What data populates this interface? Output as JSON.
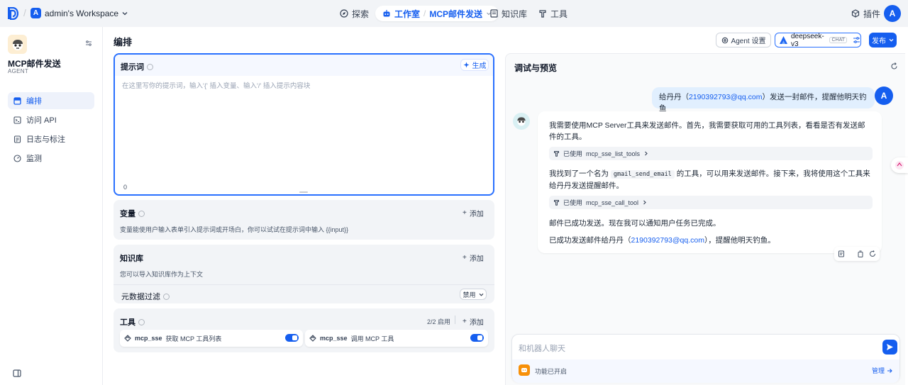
{
  "topbar": {
    "workspace_initial": "A",
    "workspace_name": "admin's Workspace",
    "nav_explore": "探索",
    "nav_studio": "工作室",
    "nav_app": "MCP邮件发送",
    "nav_knowledge": "知识库",
    "nav_tools": "工具",
    "plugins": "插件",
    "user_initial": "A"
  },
  "sidebar": {
    "app_name": "MCP邮件发送",
    "app_type": "AGENT",
    "items": [
      {
        "label": "编排",
        "icon": "layout-icon",
        "active": true
      },
      {
        "label": "访问 API",
        "icon": "terminal-icon",
        "active": false
      },
      {
        "label": "日志与标注",
        "icon": "file-list-icon",
        "active": false
      },
      {
        "label": "监测",
        "icon": "dashboard-icon",
        "active": false
      }
    ]
  },
  "header": {
    "title": "编排",
    "agent_settings": "Agent 设置",
    "model_name": "deepseek-v3",
    "model_badge": "CHAT",
    "publish": "发布"
  },
  "prompt": {
    "title": "提示词",
    "generate": "生成",
    "placeholder": "在这里写你的提示词，输入'{' 插入变量、输入'/' 插入提示内容块",
    "char_count": "0"
  },
  "variables": {
    "title": "变量",
    "add": "添加",
    "desc": "变量能使用户输入表单引入提示词或开场白，你可以试试在提示词中输入 {{input}}"
  },
  "knowledge": {
    "title": "知识库",
    "add": "添加",
    "desc": "您可以导入知识库作为上下文",
    "metadata_filter": "元数据过滤",
    "metadata_value": "禁用"
  },
  "tools": {
    "title": "工具",
    "status": "2/2 启用",
    "add": "添加",
    "items": [
      {
        "name": "mcp_sse",
        "desc": "获取 MCP 工具列表",
        "enabled": true
      },
      {
        "name": "mcp_sse",
        "desc": "调用 MCP 工具",
        "enabled": true
      }
    ]
  },
  "preview": {
    "title": "调试与预览",
    "user_message_pre": "给丹丹（",
    "user_message_email": "2190392793@qq.com",
    "user_message_post": "）发送一封邮件，提醒他明天钓鱼",
    "reply_p1": "我需要使用MCP Server工具来发送邮件。首先，我需要获取可用的工具列表，看看是否有发送邮件的工具。",
    "chip1_prefix": "已使用",
    "chip1_tool": "mcp_sse_list_tools",
    "reply_p2_pre": "我找到了一个名为",
    "reply_p2_code": "gmail_send_email",
    "reply_p2_post": "的工具，可以用来发送邮件。接下来，我将使用这个工具来给丹丹发送提醒邮件。",
    "chip2_prefix": "已使用",
    "chip2_tool": "mcp_sse_call_tool",
    "reply_p3": "邮件已成功发送。现在我可以通知用户任务已完成。",
    "reply_p4_pre": "已成功发送邮件给丹丹（",
    "reply_p4_email": "2190392793@qq.com",
    "reply_p4_post": "），提醒他明天钓鱼。",
    "input_placeholder": "和机器人聊天",
    "feature_status": "功能已开启",
    "manage": "管理"
  },
  "colors": {
    "accent": "#155eef",
    "bg": "#f2f4f7"
  }
}
